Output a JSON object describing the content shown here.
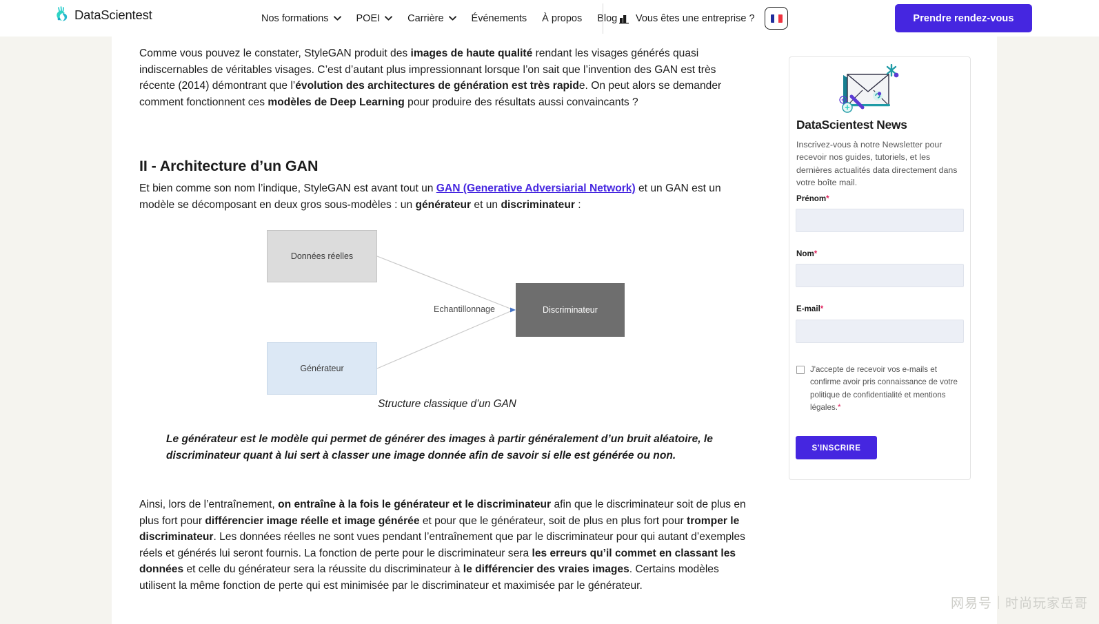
{
  "header": {
    "logo_text": "DataScientest",
    "logo_icon": "datascientest-logo-icon",
    "nav": [
      {
        "label": "Nos formations",
        "has_dropdown": true
      },
      {
        "label": "POEI",
        "has_dropdown": true
      },
      {
        "label": "Carrière",
        "has_dropdown": true
      },
      {
        "label": "Événements",
        "has_dropdown": false
      },
      {
        "label": "À propos",
        "has_dropdown": false
      },
      {
        "label": "Blog",
        "has_dropdown": false
      }
    ],
    "business_link": "Vous êtes une entreprise ?",
    "business_icon": "company-building-icon",
    "language_flag": "french-flag-icon",
    "cta_label": "Prendre rendez-vous",
    "accent_color": "#4526e0"
  },
  "article": {
    "intro_p1_part1": "Comme vous pouvez le constater, StyleGAN produit des ",
    "intro_p1_bold1": "images de haute qualité",
    "intro_p1_part2": " rendant les visages générés quasi indiscernables de véritables visages. C’est d’autant plus impressionnant lorsque l’on sait que l’invention des GAN est très récente (2014) démontrant que l’",
    "intro_p1_bold2": "évolution des architectures de génération est très rapid",
    "intro_p1_part3": "e. On peut alors se demander comment fonctionnent ces ",
    "intro_p1_bold3": "modèles de Deep Learning",
    "intro_p1_part4": " pour produire des résultats aussi convaincants ?",
    "heading": "II - Architecture d’un GAN",
    "p2_part1": "Et bien comme son nom l’indique, StyleGAN est avant tout un ",
    "p2_link": "GAN (Generative Adversiarial Network)",
    "p2_part2": " et un GAN est un modèle se décomposant en deux gros sous-modèles : un ",
    "p2_bold1": "générateur",
    "p2_part3": " et un ",
    "p2_bold2": "discriminateur",
    "p2_part4": " :",
    "emphasis": "Le générateur est le modèle qui permet de générer des images à partir généralement d’un bruit aléatoire, le discriminateur quant à lui sert à classer une image donnée afin de savoir si elle est générée ou non.",
    "p3_part1": "Ainsi, lors de l’entraînement, ",
    "p3_bold1": "on entraîne à la fois le générateur et le discriminateur",
    "p3_part2": " afin que le discriminateur soit de plus en plus fort pour ",
    "p3_bold2": "différencier image réelle et image générée",
    "p3_part3": " et pour que le générateur, soit de plus en plus fort pour ",
    "p3_bold3": "tromper le discriminateur",
    "p3_part4": ". Les données réelles ne sont vues pendant l’entraînement que par le discriminateur pour qui autant d’exemples réels et générés lui seront fournis. La fonction de perte pour le discriminateur sera ",
    "p3_bold4": "les erreurs qu’il commet en classant les données",
    "p3_part5": " et celle du générateur sera la réussite du discriminateur à ",
    "p3_bold5": "le différencier des vraies images",
    "p3_part6": ". Certains modèles utilisent la même fonction de perte qui est minimisée par le discriminateur et maximisée par le générateur."
  },
  "diagram": {
    "box_real_data": "Données réelles",
    "box_generator": "Générateur",
    "box_discriminator": "Discriminateur",
    "edge_label": "Echantillonnage",
    "caption": "Structure classique d’un GAN",
    "colors": {
      "real_data_fill": "#dcdcdc",
      "generator_fill": "#dce8f5",
      "discriminator_fill": "#6e6e6e"
    }
  },
  "newsletter": {
    "illustration": "envelope-newsletter-icon",
    "title": "DataScientest News",
    "description": "Inscrivez-vous à notre Newsletter pour recevoir nos guides, tutoriels, et les dernières actualités data directement dans votre boîte mail.",
    "fields": [
      {
        "label": "Prénom",
        "required": "*",
        "value": "",
        "placeholder": ""
      },
      {
        "label": "Nom",
        "required": "*",
        "value": "",
        "placeholder": ""
      },
      {
        "label": "E-mail",
        "required": "*",
        "value": "",
        "placeholder": ""
      }
    ],
    "consent_text": "J'accepte de recevoir vos e-mails et confirme avoir pris connaissance de votre politique de confidentialité et mentions légales.",
    "consent_required": "*",
    "consent_checked": false,
    "submit_label": "S'INSCRIRE"
  },
  "watermark": {
    "left": "网易号",
    "right": "时尚玩家岳哥"
  }
}
